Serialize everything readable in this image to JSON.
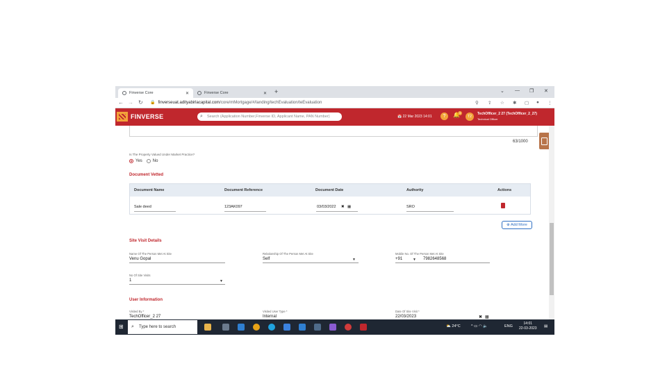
{
  "browser": {
    "tabs": [
      {
        "title": "Finverse Core",
        "active": true
      },
      {
        "title": "Finverse Core",
        "active": false
      }
    ],
    "url_host": "finverseuat.adityabirlacapital.com",
    "url_path": "/core/mMortgage/#/landing/techEvaluation/teEvaluation"
  },
  "app": {
    "brand": "FINVERSE",
    "search_placeholder": "Search (Application Number,Finverse ID, Applicant Name, PAN Number)",
    "datetime": "22 Mar 2023 14:01",
    "notification_count": "3",
    "avatar_initials": "T2",
    "user_name": "TechOfficer_2 27 (TechOfficer_2_27)",
    "user_role": "Technical Officer"
  },
  "form": {
    "char_count": "63/1000",
    "market_practice_question": "Is The Property Valued Under Market Practice?",
    "radio_yes": "Yes",
    "radio_no": "No",
    "document_vetted_title": "Document Vetted",
    "table_headers": [
      "Document Name",
      "Document Reference",
      "Document Date",
      "Authority",
      "Actions"
    ],
    "table_row": {
      "name": "Sale deed",
      "reference": "123AK097",
      "date": "03/03/2022",
      "authority": "SRO"
    },
    "add_more_label": "Add More",
    "site_visit_title": "Site Visit Details",
    "person_met_label": "Name Of The Person Met At Site",
    "person_met_value": "Venu Gopal",
    "relationship_label": "Relationship Of The Person Met At Site",
    "relationship_value": "Self",
    "mobile_label": "Mobile No. Of The Person Met At Site",
    "mobile_code": "+91",
    "mobile_value": "7982648568",
    "site_visits_label": "No Of Site Visits",
    "site_visits_value": "1",
    "user_info_title": "User Information",
    "visited_by_label": "Visited By *",
    "visited_by_value": "TechOfficer_2 27",
    "visited_user_type_label": "Visited User Type *",
    "visited_user_type_value": "Internal",
    "date_of_visit_label": "Date Of Site Visit *",
    "date_of_visit_value": "22/03/2023"
  },
  "taskbar": {
    "search_placeholder": "Type here to search",
    "weather": "24°C",
    "lang": "ENG",
    "time": "14:01",
    "date": "22-03-2023",
    "notif_badge": "21"
  },
  "colors": {
    "brand_red": "#c0272d",
    "accent_orange": "#f2a33a",
    "link_blue": "#2e6fc3"
  }
}
